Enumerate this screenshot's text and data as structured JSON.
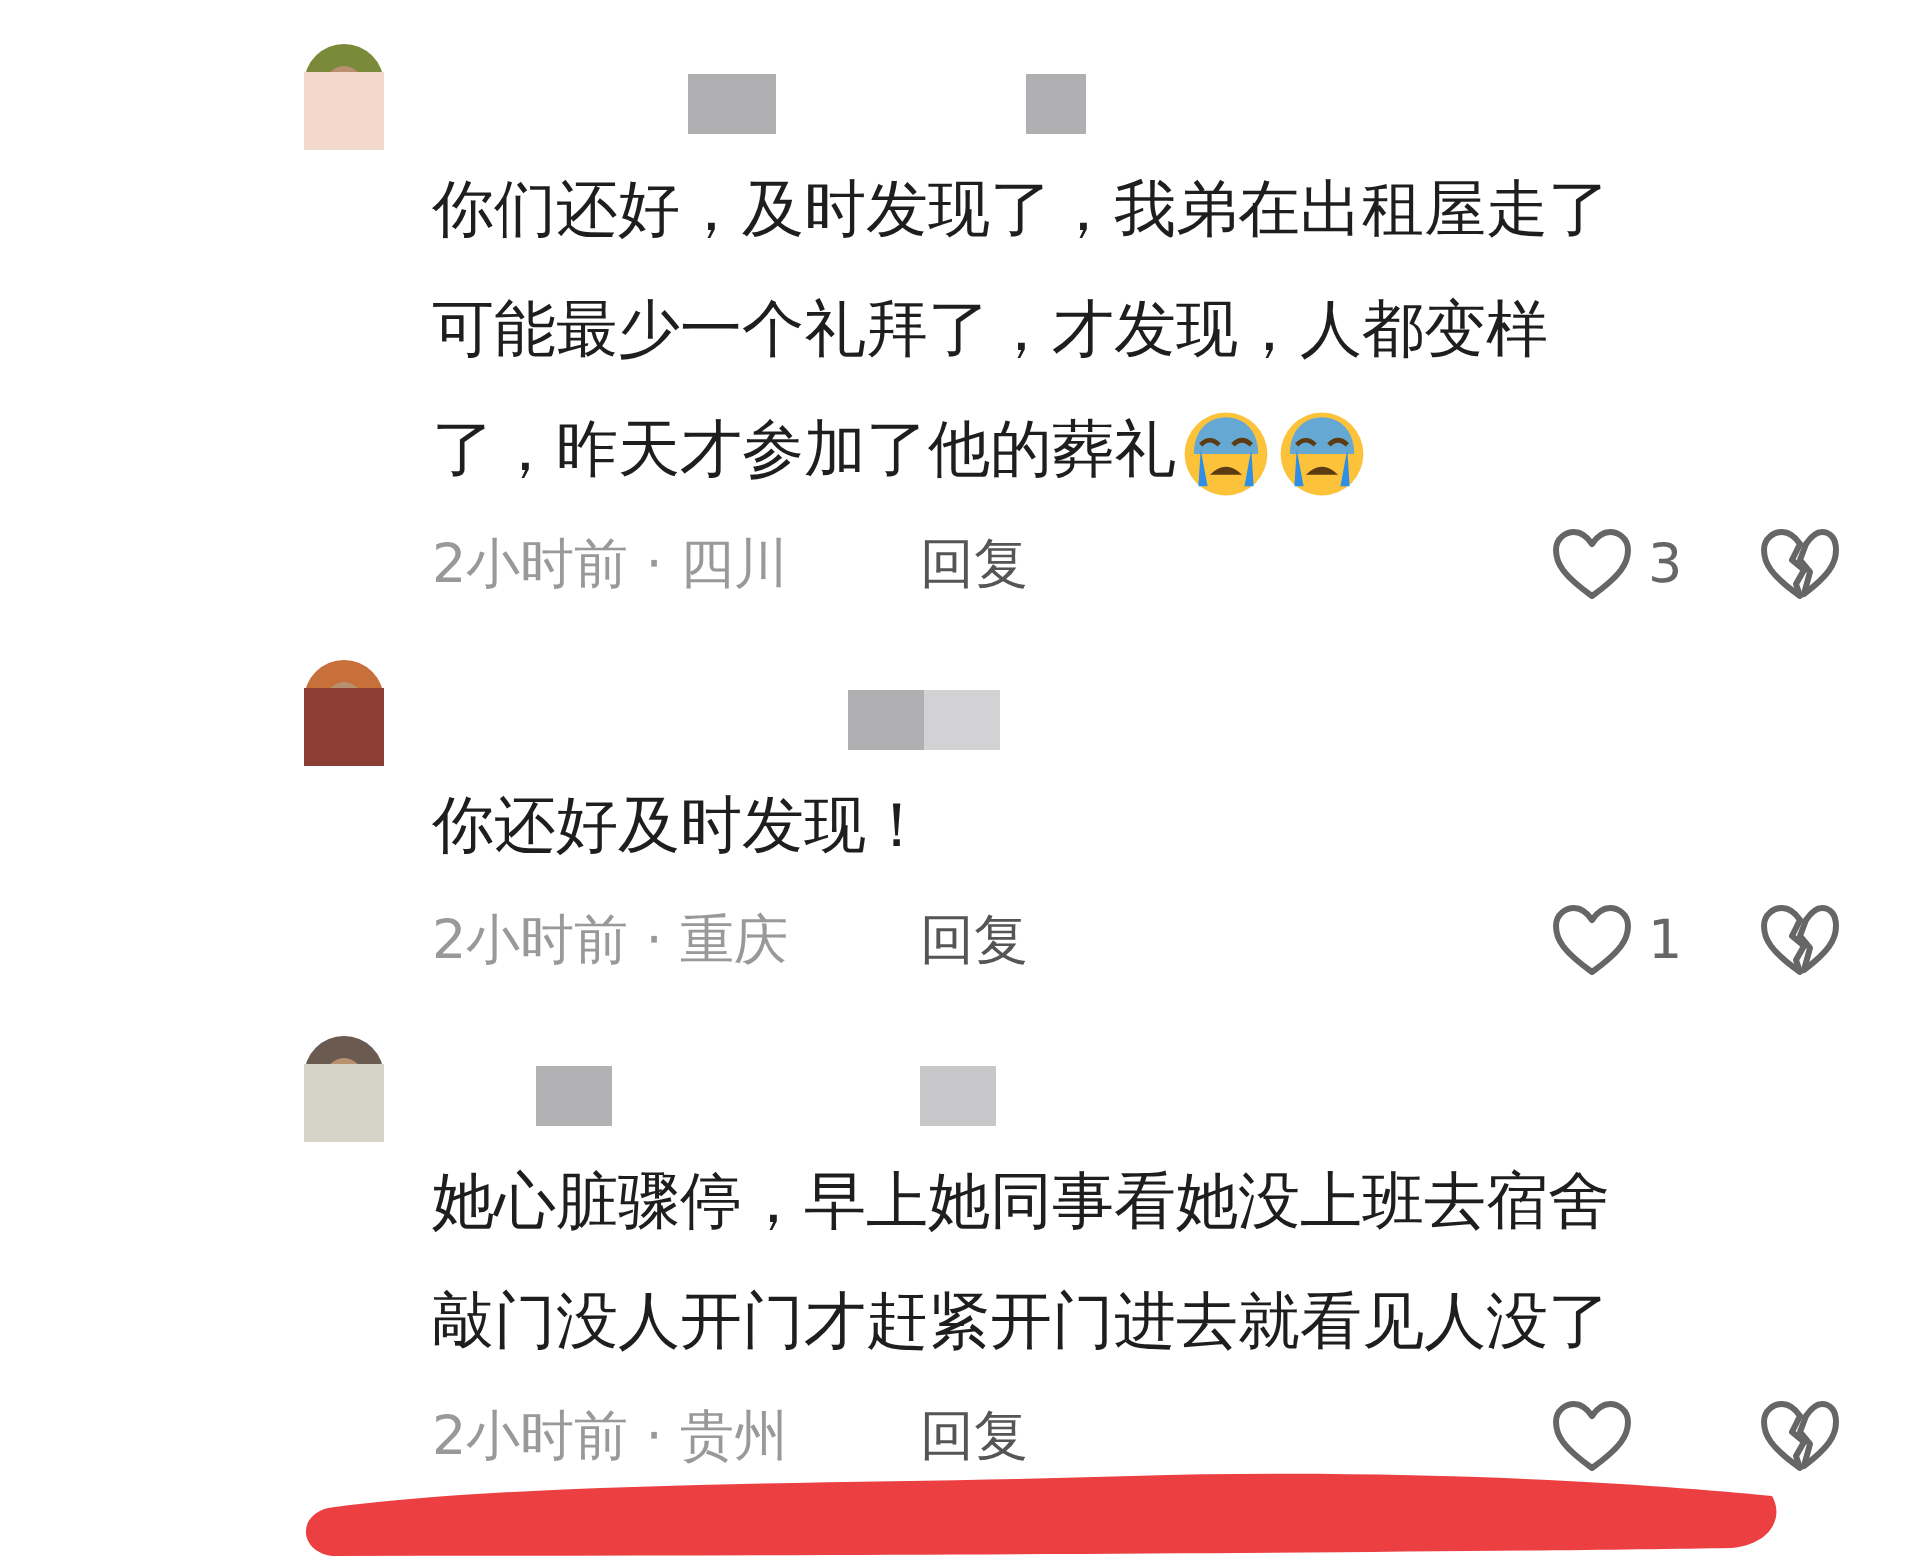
{
  "comments": [
    {
      "lines": [
        "你们还好，及时发现了，我弟在出租屋走了",
        "可能最少一个礼拜了，才发现，人都变样",
        "了，昨天才参加了他的葬礼"
      ],
      "emoji": [
        {
          "kind": "crying"
        },
        {
          "kind": "crying"
        }
      ],
      "meta": "2小时前 · 四川",
      "reply": "回复",
      "likes": "3"
    },
    {
      "lines": [
        "你还好及时发现！"
      ],
      "meta": "2小时前 · 重庆",
      "reply": "回复",
      "likes": "1"
    },
    {
      "lines": [
        "她心脏骤停，早上她同事看她没上班去宿舍",
        "敲门没人开门才赶紧开门进去就看见人没了"
      ],
      "meta": "2小时前 · 贵州",
      "reply": "回复"
    }
  ]
}
